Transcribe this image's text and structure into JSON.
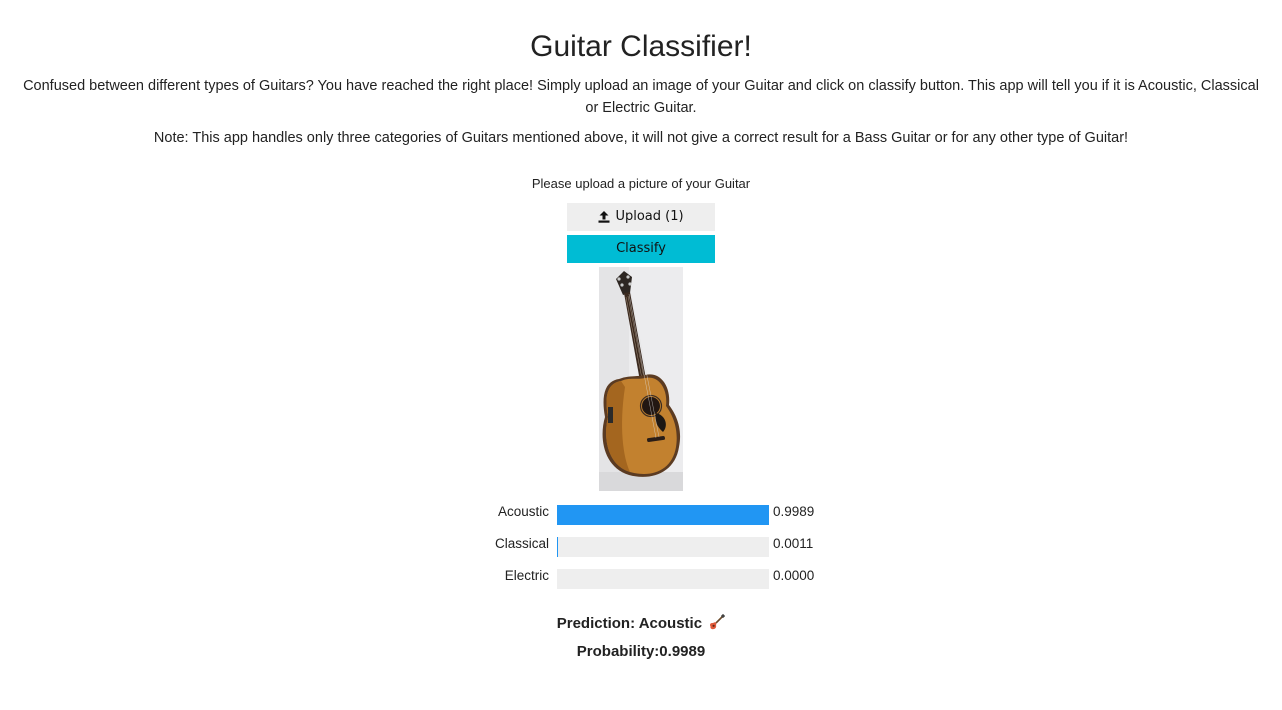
{
  "header": {
    "title": "Guitar Classifier!",
    "description": "Confused between different types of Guitars? You have reached the right place! Simply upload an image of your Guitar and click on classify button. This app will tell you if it is Acoustic, Classical or Electric Guitar.",
    "note": "Note: This app handles only three categories of Guitars mentioned above, it will not give a correct result for a Bass Guitar or for any other type of Guitar!"
  },
  "upload": {
    "prompt": "Please upload a picture of your Guitar",
    "button_label": "Upload (1)",
    "icon": "upload-icon"
  },
  "classify": {
    "button_label": "Classify"
  },
  "image": {
    "subject": "acoustic-guitar-photo"
  },
  "results": [
    {
      "label": "Acoustic",
      "value": "0.9989",
      "fraction": 0.9989
    },
    {
      "label": "Classical",
      "value": "0.0011",
      "fraction": 0.0011
    },
    {
      "label": "Electric",
      "value": "0.0000",
      "fraction": 0.0
    }
  ],
  "prediction": {
    "text": "Prediction: Acoustic",
    "emoji_icon": "guitar-icon",
    "probability_text": "Probability:0.9989"
  },
  "colors": {
    "classify_button": "#00bcd4",
    "upload_button": "#eeeeee",
    "bar_fill": "#2196f3",
    "bar_track": "#eeeeee"
  }
}
